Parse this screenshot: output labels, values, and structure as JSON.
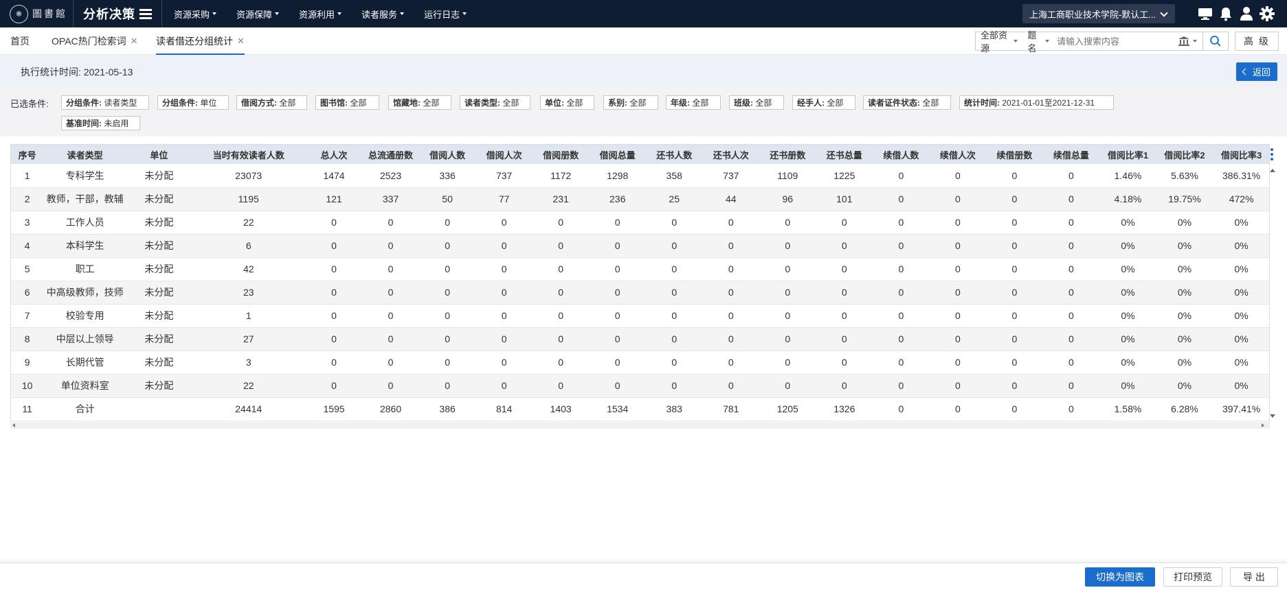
{
  "topbar": {
    "logo_text": "圖書館",
    "app_title": "分析决策",
    "nav": [
      "资源采购",
      "资源保障",
      "资源利用",
      "读者服务",
      "运行日志"
    ],
    "org": "上海工商职业技术学院-默认工...",
    "icons": [
      "monitor-icon",
      "bell-icon",
      "user-icon",
      "gear-icon"
    ]
  },
  "tabs": [
    {
      "label": "首页",
      "closable": false
    },
    {
      "label": "OPAC热门检索词",
      "closable": true
    },
    {
      "label": "读者借还分组统计",
      "closable": true,
      "active": true
    }
  ],
  "search": {
    "scope": "全部资源",
    "field": "题名",
    "placeholder": "请输入搜索内容",
    "advanced_label": "高 级"
  },
  "info": {
    "exec_time_label": "执行统计时间:",
    "exec_time_value": "2021-05-13",
    "back_label": "返回"
  },
  "conditions": {
    "label": "已选条件:",
    "chips": [
      {
        "key": "分组条件:",
        "value": "读者类型"
      },
      {
        "key": "分组条件:",
        "value": "单位"
      },
      {
        "key": "借阅方式:",
        "value": "全部"
      },
      {
        "key": "图书馆:",
        "value": "全部"
      },
      {
        "key": "馆藏地:",
        "value": "全部"
      },
      {
        "key": "读者类型:",
        "value": "全部"
      },
      {
        "key": "单位:",
        "value": "全部"
      },
      {
        "key": "系别:",
        "value": "全部"
      },
      {
        "key": "年级:",
        "value": "全部"
      },
      {
        "key": "班级:",
        "value": "全部"
      },
      {
        "key": "经手人:",
        "value": "全部"
      },
      {
        "key": "读者证件状态:",
        "value": "全部"
      },
      {
        "key": "统计时间:",
        "value": "2021-01-01至2021-12-31"
      },
      {
        "key": "基准时间:",
        "value": "未启用"
      }
    ]
  },
  "table": {
    "headers": [
      "序号",
      "读者类型",
      "单位",
      "当时有效读者人数",
      "总人次",
      "总流通册数",
      "借阅人数",
      "借阅人次",
      "借阅册数",
      "借阅总量",
      "还书人数",
      "还书人次",
      "还书册数",
      "还书总量",
      "续借人数",
      "续借人次",
      "续借册数",
      "续借总量",
      "借阅比率1",
      "借阅比率2",
      "借阅比率3"
    ],
    "rows": [
      [
        "1",
        "专科学生",
        "未分配",
        "23073",
        "1474",
        "2523",
        "336",
        "737",
        "1172",
        "1298",
        "358",
        "737",
        "1109",
        "1225",
        "0",
        "0",
        "0",
        "0",
        "1.46%",
        "5.63%",
        "386.31%"
      ],
      [
        "2",
        "教师，干部，教辅",
        "未分配",
        "1195",
        "121",
        "337",
        "50",
        "77",
        "231",
        "236",
        "25",
        "44",
        "96",
        "101",
        "0",
        "0",
        "0",
        "0",
        "4.18%",
        "19.75%",
        "472%"
      ],
      [
        "3",
        "工作人员",
        "未分配",
        "22",
        "0",
        "0",
        "0",
        "0",
        "0",
        "0",
        "0",
        "0",
        "0",
        "0",
        "0",
        "0",
        "0",
        "0",
        "0%",
        "0%",
        "0%"
      ],
      [
        "4",
        "本科学生",
        "未分配",
        "6",
        "0",
        "0",
        "0",
        "0",
        "0",
        "0",
        "0",
        "0",
        "0",
        "0",
        "0",
        "0",
        "0",
        "0",
        "0%",
        "0%",
        "0%"
      ],
      [
        "5",
        "职工",
        "未分配",
        "42",
        "0",
        "0",
        "0",
        "0",
        "0",
        "0",
        "0",
        "0",
        "0",
        "0",
        "0",
        "0",
        "0",
        "0",
        "0%",
        "0%",
        "0%"
      ],
      [
        "6",
        "中高级教师，技师",
        "未分配",
        "23",
        "0",
        "0",
        "0",
        "0",
        "0",
        "0",
        "0",
        "0",
        "0",
        "0",
        "0",
        "0",
        "0",
        "0",
        "0%",
        "0%",
        "0%"
      ],
      [
        "7",
        "校验专用",
        "未分配",
        "1",
        "0",
        "0",
        "0",
        "0",
        "0",
        "0",
        "0",
        "0",
        "0",
        "0",
        "0",
        "0",
        "0",
        "0",
        "0%",
        "0%",
        "0%"
      ],
      [
        "8",
        "中层以上领导",
        "未分配",
        "27",
        "0",
        "0",
        "0",
        "0",
        "0",
        "0",
        "0",
        "0",
        "0",
        "0",
        "0",
        "0",
        "0",
        "0",
        "0%",
        "0%",
        "0%"
      ],
      [
        "9",
        "长期代管",
        "未分配",
        "3",
        "0",
        "0",
        "0",
        "0",
        "0",
        "0",
        "0",
        "0",
        "0",
        "0",
        "0",
        "0",
        "0",
        "0",
        "0%",
        "0%",
        "0%"
      ],
      [
        "10",
        "单位资料室",
        "未分配",
        "22",
        "0",
        "0",
        "0",
        "0",
        "0",
        "0",
        "0",
        "0",
        "0",
        "0",
        "0",
        "0",
        "0",
        "0",
        "0%",
        "0%",
        "0%"
      ],
      [
        "11",
        "合计",
        "",
        "24414",
        "1595",
        "2860",
        "386",
        "814",
        "1403",
        "1534",
        "383",
        "781",
        "1205",
        "1326",
        "0",
        "0",
        "0",
        "0",
        "1.58%",
        "6.28%",
        "397.41%"
      ]
    ]
  },
  "bottom": {
    "switch_chart": "切换为图表",
    "print_preview": "打印预览",
    "export": "导 出"
  },
  "colors": {
    "topbar_bg": "#0f1d33",
    "primary": "#1a6dcc",
    "header_bg": "#dfe6ef"
  }
}
